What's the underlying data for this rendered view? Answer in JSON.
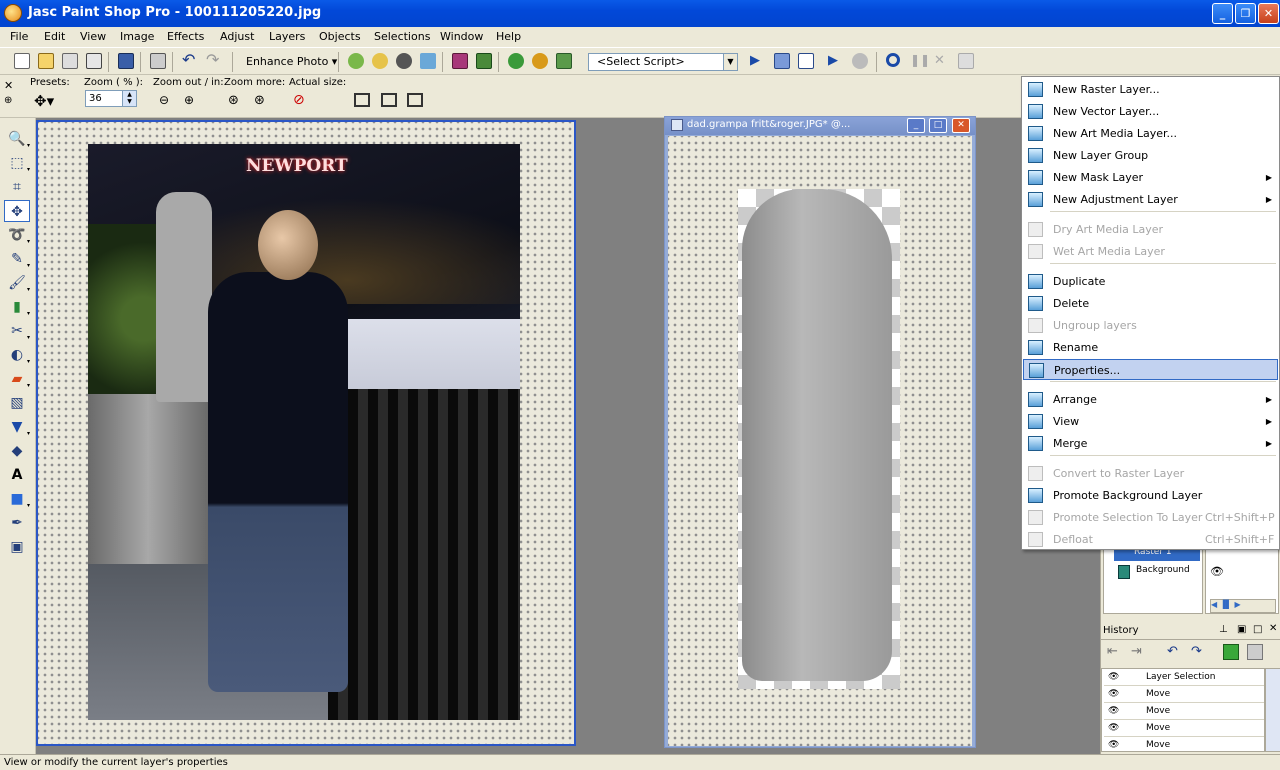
{
  "window": {
    "title": "Jasc Paint Shop Pro - 100111205220.jpg",
    "controls": [
      "_",
      "❐",
      "✕"
    ]
  },
  "menubar": [
    "File",
    "Edit",
    "View",
    "Image",
    "Effects",
    "Adjust",
    "Layers",
    "Objects",
    "Selections",
    "Window",
    "Help"
  ],
  "toolbar": {
    "enhance_photo": "Enhance Photo",
    "select_script": "<Select Script>"
  },
  "tool_options": {
    "presets_label": "Presets:",
    "zoom_label": "Zoom ( % ):",
    "zoom_value": "36",
    "zoom_out_in_label": "Zoom out / in:",
    "zoom_more_label": "Zoom more:",
    "actual_size_label": "Actual size:"
  },
  "documents": {
    "doc1_sign": "NEWPORT",
    "doc2_title": "dad.grampa fritt&roger.JPG* @..."
  },
  "context_menu": {
    "items": [
      {
        "label": "New Raster Layer...",
        "shortcut": "",
        "submenu": false,
        "disabled": false
      },
      {
        "label": "New Vector Layer...",
        "shortcut": "",
        "submenu": false,
        "disabled": false
      },
      {
        "label": "New Art Media Layer...",
        "shortcut": "",
        "submenu": false,
        "disabled": false
      },
      {
        "label": "New Layer Group",
        "shortcut": "",
        "submenu": false,
        "disabled": false
      },
      {
        "label": "New Mask Layer",
        "shortcut": "",
        "submenu": true,
        "disabled": false
      },
      {
        "label": "New Adjustment Layer",
        "shortcut": "",
        "submenu": true,
        "disabled": false
      },
      {
        "label": "Dry Art Media Layer",
        "shortcut": "",
        "submenu": false,
        "disabled": true
      },
      {
        "label": "Wet Art Media Layer",
        "shortcut": "",
        "submenu": false,
        "disabled": true
      },
      {
        "label": "Duplicate",
        "shortcut": "",
        "submenu": false,
        "disabled": false
      },
      {
        "label": "Delete",
        "shortcut": "",
        "submenu": false,
        "disabled": false
      },
      {
        "label": "Ungroup layers",
        "shortcut": "",
        "submenu": false,
        "disabled": true
      },
      {
        "label": "Rename",
        "shortcut": "",
        "submenu": false,
        "disabled": false
      },
      {
        "label": "Properties...",
        "shortcut": "",
        "submenu": false,
        "disabled": false,
        "highlighted": true
      },
      {
        "label": "Arrange",
        "shortcut": "",
        "submenu": true,
        "disabled": false
      },
      {
        "label": "View",
        "shortcut": "",
        "submenu": true,
        "disabled": false
      },
      {
        "label": "Merge",
        "shortcut": "",
        "submenu": true,
        "disabled": false
      },
      {
        "label": "Convert to Raster Layer",
        "shortcut": "",
        "submenu": false,
        "disabled": true
      },
      {
        "label": "Promote Background Layer",
        "shortcut": "",
        "submenu": false,
        "disabled": false
      },
      {
        "label": "Promote Selection To Layer",
        "shortcut": "Ctrl+Shift+P",
        "submenu": false,
        "disabled": true
      },
      {
        "label": "Defloat",
        "shortcut": "Ctrl+Shift+F",
        "submenu": false,
        "disabled": true
      }
    ]
  },
  "layers_panel": {
    "layers": [
      "Raster 1",
      "Background"
    ]
  },
  "history_panel": {
    "title": "History",
    "entries": [
      "Layer Selection",
      "Move",
      "Move",
      "Move",
      "Move"
    ]
  },
  "statusbar": {
    "text": "View or modify the current layer's properties"
  }
}
